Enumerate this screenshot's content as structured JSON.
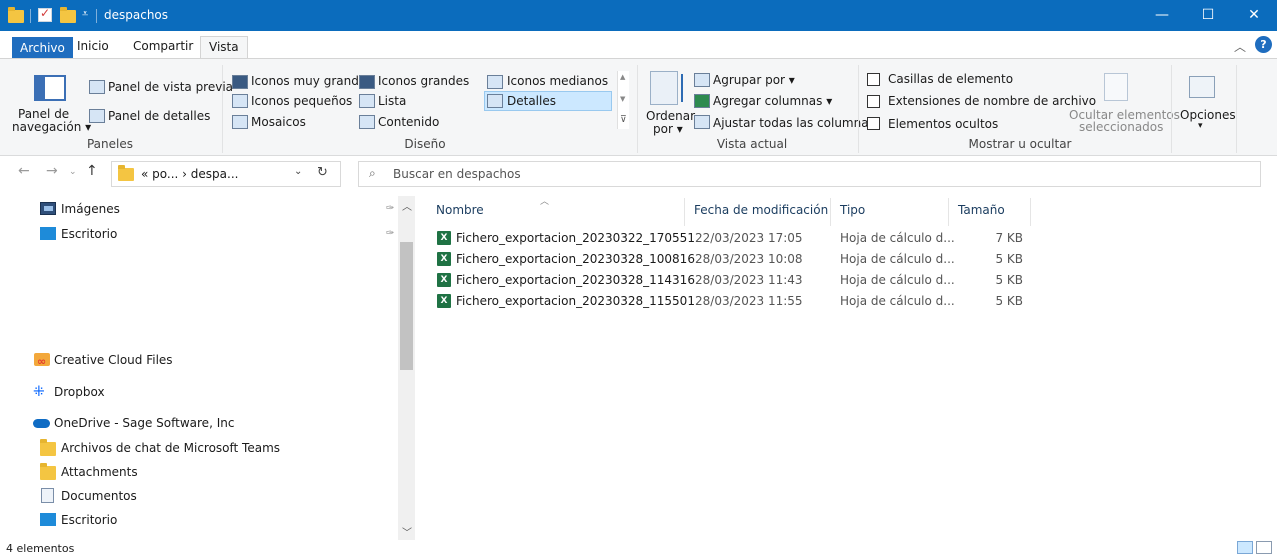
{
  "window": {
    "title": "despachos"
  },
  "colors": {
    "titlebar": "#0b6cbd",
    "file_tab": "#1f6dbf",
    "selected": "#cce8ff",
    "excel": "#1f7244"
  },
  "window_controls": {
    "minimize": "—",
    "maximize": "☐",
    "close": "✕"
  },
  "tabs": [
    {
      "label": "Archivo"
    },
    {
      "label": "Inicio"
    },
    {
      "label": "Compartir"
    },
    {
      "label": "Vista",
      "active": true
    }
  ],
  "ribbon": {
    "paneles": {
      "nav_pane_line1": "Panel de",
      "nav_pane_line2": "navegación ▾",
      "preview": "Panel de vista previa",
      "details": "Panel de detalles",
      "label": "Paneles"
    },
    "diseno": {
      "items": [
        "Iconos muy grandes",
        "Iconos grandes",
        "Iconos medianos",
        "Iconos pequeños",
        "Lista",
        "Detalles",
        "Mosaicos",
        "Contenido"
      ],
      "selected": "Detalles",
      "label": "Diseño"
    },
    "vista_actual": {
      "sort_line1": "Ordenar",
      "sort_line2": "por ▾",
      "group_by": "Agrupar por ▾",
      "add_columns": "Agregar columnas ▾",
      "fit_columns": "Ajustar todas las columnas",
      "label": "Vista actual"
    },
    "mostrar": {
      "item_checkboxes": "Casillas de elemento",
      "extensions": "Extensiones de nombre de archivo",
      "hidden_items": "Elementos ocultos",
      "hide_selected_line1": "Ocultar elementos",
      "hide_selected_line2": "seleccionados",
      "options": "Opciones",
      "label": "Mostrar u ocultar"
    }
  },
  "address": {
    "path": "« po... › despa...",
    "search_placeholder": "Buscar en despachos"
  },
  "nav_pane": {
    "items": [
      {
        "label": "Imágenes",
        "icon": "pictures-icon"
      },
      {
        "label": "Escritorio",
        "icon": "desktop-icon"
      },
      {
        "label": "Creative Cloud Files",
        "icon": "creative-cloud-icon"
      },
      {
        "label": "Dropbox",
        "icon": "dropbox-icon"
      },
      {
        "label": "OneDrive - Sage Software, Inc",
        "icon": "onedrive-icon"
      },
      {
        "label": "Archivos de chat de Microsoft Teams",
        "icon": "folder-icon"
      },
      {
        "label": "Attachments",
        "icon": "folder-icon"
      },
      {
        "label": "Documentos",
        "icon": "documents-icon"
      },
      {
        "label": "Escritorio",
        "icon": "desktop-icon"
      }
    ]
  },
  "columns": {
    "name": "Nombre",
    "modified": "Fecha de modificación",
    "type": "Tipo",
    "size": "Tamaño"
  },
  "files": [
    {
      "name": "Fichero_exportacion_20230322_170551",
      "modified": "22/03/2023 17:05",
      "type": "Hoja de cálculo d...",
      "size": "7 KB"
    },
    {
      "name": "Fichero_exportacion_20230328_100816",
      "modified": "28/03/2023 10:08",
      "type": "Hoja de cálculo d...",
      "size": "5 KB"
    },
    {
      "name": "Fichero_exportacion_20230328_114316",
      "modified": "28/03/2023 11:43",
      "type": "Hoja de cálculo d...",
      "size": "5 KB"
    },
    {
      "name": "Fichero_exportacion_20230328_115501",
      "modified": "28/03/2023 11:55",
      "type": "Hoja de cálculo d...",
      "size": "5 KB"
    }
  ],
  "status": {
    "count": "4 elementos"
  }
}
